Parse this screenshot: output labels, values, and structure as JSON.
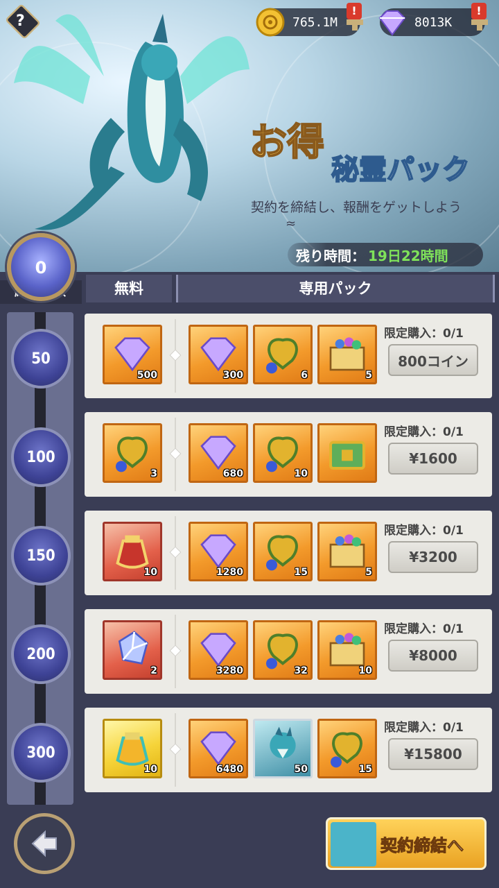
{
  "header": {
    "help_label": "?",
    "coins": "765.1M",
    "gems": "8013K",
    "alert_mark": "!"
  },
  "banner": {
    "title_big": "お得",
    "title_sub": "秘霊パック",
    "subtitle": "契約を締結し、報酬をゲットしよう",
    "wave": "≈",
    "timer_label": "残り時間：",
    "timer_value": "19日22時間"
  },
  "count": {
    "value": "0",
    "label": "締結回数"
  },
  "tabs": {
    "free": "無料",
    "exclusive": "専用パック"
  },
  "rows": [
    {
      "tier": "50",
      "free": {
        "icon": "gem",
        "qty": "500"
      },
      "items": [
        {
          "icon": "gem",
          "qty": "300"
        },
        {
          "icon": "wings-timer",
          "qty": "6"
        },
        {
          "icon": "chest",
          "qty": "5"
        }
      ],
      "limit": "限定購入：0/1",
      "price": "800コイン"
    },
    {
      "tier": "100",
      "free": {
        "icon": "wings-timer",
        "qty": "3"
      },
      "items": [
        {
          "icon": "gem",
          "qty": "680"
        },
        {
          "icon": "wings-timer",
          "qty": "10"
        },
        {
          "icon": "green-chest",
          "qty": ""
        }
      ],
      "limit": "限定購入：0/1",
      "price": "¥1600"
    },
    {
      "tier": "150",
      "free": {
        "icon": "red-bag",
        "qty": "10"
      },
      "items": [
        {
          "icon": "gem",
          "qty": "1280"
        },
        {
          "icon": "wings-timer",
          "qty": "15"
        },
        {
          "icon": "chest",
          "qty": "5"
        }
      ],
      "limit": "限定購入：0/1",
      "price": "¥3200"
    },
    {
      "tier": "200",
      "free": {
        "icon": "crystal",
        "qty": "2"
      },
      "items": [
        {
          "icon": "gem",
          "qty": "3280"
        },
        {
          "icon": "wings-timer",
          "qty": "32"
        },
        {
          "icon": "chest",
          "qty": "10"
        }
      ],
      "limit": "限定購入：0/1",
      "price": "¥8000"
    },
    {
      "tier": "300",
      "free": {
        "icon": "gold-bag",
        "qty": "10"
      },
      "items": [
        {
          "icon": "gem",
          "qty": "6480"
        },
        {
          "icon": "dragon-portrait",
          "qty": "50"
        },
        {
          "icon": "wings-timer",
          "qty": "15"
        }
      ],
      "limit": "限定購入：0/1",
      "price": "¥15800"
    }
  ],
  "bottom": {
    "cta": "契約締結へ"
  },
  "colors": {
    "accent": "#f39a2b",
    "timer": "#7fe25a",
    "panel": "#3a3d55"
  }
}
